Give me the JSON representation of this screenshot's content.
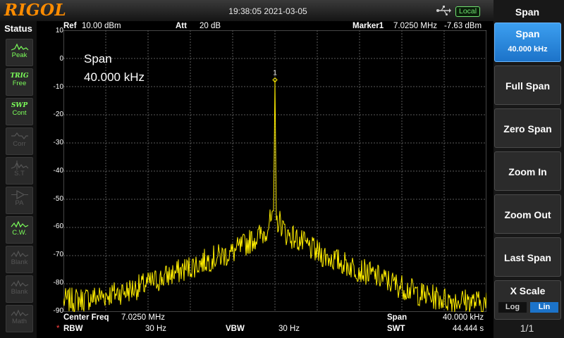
{
  "header": {
    "logo": "RIGOL",
    "datetime": "19:38:05 2021-03-05",
    "remote_status": "Local"
  },
  "status_panel": {
    "title": "Status",
    "items": [
      {
        "label": "Peak",
        "state": "active",
        "icon": "peak-icon"
      },
      {
        "tag": "TRIG",
        "label": "Free",
        "state": "active",
        "icon": "trig-icon"
      },
      {
        "tag": "SWP",
        "label": "Cont",
        "state": "active",
        "icon": "sweep-icon"
      },
      {
        "label": "Corr",
        "state": "dim",
        "icon": "corr-icon"
      },
      {
        "label": "S.T",
        "state": "dim",
        "icon": "signal-track-icon"
      },
      {
        "label": "PA",
        "state": "dim",
        "icon": "pa-icon"
      },
      {
        "label": "C.W.",
        "state": "active",
        "icon": "cw-icon"
      },
      {
        "label": "Blank",
        "state": "dim",
        "icon": "blank-icon"
      },
      {
        "label": "Blank",
        "state": "dim",
        "icon": "blank-icon"
      },
      {
        "label": "Math",
        "state": "dim",
        "icon": "math-icon"
      }
    ]
  },
  "measurement_bar": {
    "ref_label": "Ref",
    "ref_value": "10.00 dBm",
    "att_label": "Att",
    "att_value": "20 dB",
    "marker_label": "Marker1",
    "marker_freq": "7.0250 MHz",
    "marker_level": "-7.63 dBm"
  },
  "overlay": {
    "title": "Span",
    "value": "40.000 kHz"
  },
  "marker_number": "1",
  "bottom_bar": {
    "center_label": "Center Freq",
    "center_value": "7.0250 MHz",
    "span_label": "Span",
    "span_value": "40.000 kHz",
    "rbw_star": "*",
    "rbw_label": "RBW",
    "rbw_value": "30 Hz",
    "vbw_label": "VBW",
    "vbw_value": "30 Hz",
    "swt_label": "SWT",
    "swt_value": "44.444 s"
  },
  "softkey_menu": {
    "title": "Span",
    "buttons": [
      {
        "label": "Span",
        "value": "40.000 kHz",
        "selected": true
      },
      {
        "label": "Full Span"
      },
      {
        "label": "Zero Span"
      },
      {
        "label": "Zoom In"
      },
      {
        "label": "Zoom Out"
      },
      {
        "label": "Last Span"
      },
      {
        "label": "X Scale",
        "options": [
          "Log",
          "Lin"
        ],
        "active_option": "Lin"
      }
    ],
    "page": "1/1"
  },
  "colors": {
    "trace": "#ffee00",
    "accent": "#1c73c9",
    "logo": "#ff8c00",
    "status_active": "#7cff5a"
  },
  "chart_data": {
    "type": "line",
    "x_unit": "MHz",
    "x_center": 7.025,
    "x_span_khz": 40.0,
    "y_unit": "dBm",
    "y_ticks": [
      "10",
      "0",
      "-10",
      "-20",
      "-30",
      "-40",
      "-50",
      "-60",
      "-70",
      "-80",
      "-90"
    ],
    "ylim": [
      -90,
      10
    ],
    "grid": true,
    "series": [
      {
        "x_khz_offset": [
          -20,
          -18,
          -16,
          -14,
          -12,
          -10,
          -8,
          -6,
          -4,
          -2,
          -1,
          -0.5,
          0,
          0.5,
          1,
          2,
          4,
          6,
          8,
          10,
          12,
          14,
          16,
          18,
          20
        ],
        "values": [
          -86,
          -85.5,
          -84,
          -82.5,
          -80,
          -77,
          -74,
          -71,
          -69,
          -64,
          -62,
          -58,
          -7.63,
          -58,
          -62,
          -64,
          -69,
          -72,
          -75,
          -78,
          -81,
          -84,
          -85.5,
          -86,
          -87
        ]
      }
    ],
    "marker": {
      "x_khz_offset": 0,
      "value": -7.63,
      "label": "1"
    }
  }
}
